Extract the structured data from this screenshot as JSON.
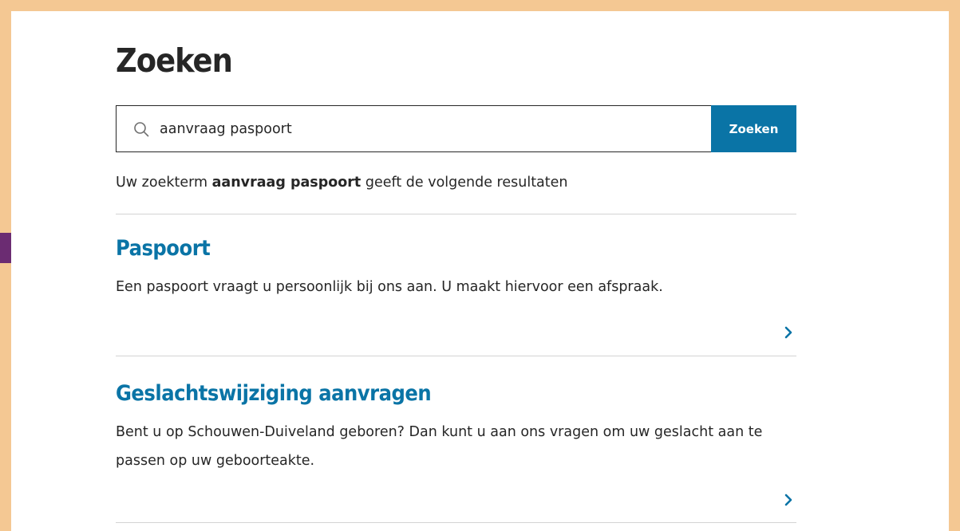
{
  "page": {
    "title": "Zoeken"
  },
  "search": {
    "value": "aanvraag paspoort",
    "button_label": "Zoeken"
  },
  "summary": {
    "prefix": "Uw zoekterm ",
    "term": "aanvraag paspoort",
    "suffix": " geeft de volgende resultaten"
  },
  "results": [
    {
      "title": "Paspoort",
      "description": "Een paspoort vraagt u persoonlijk bij ons aan. U maakt hiervoor een afspraak."
    },
    {
      "title": "Geslachtswijziging aanvragen",
      "description": "Bent u op Schouwen-Duiveland geboren? Dan kunt u aan ons vragen om uw geslacht aan te passen op uw geboorteakte."
    }
  ],
  "colors": {
    "border_frame": "#f4c893",
    "accent": "#0a74a6",
    "annotation_arrow": "#6b2c72",
    "text": "#262626",
    "divider": "#d3d3d3"
  },
  "icons": {
    "search": "search-icon",
    "result_link": "chevron-right-icon",
    "annotation": "arrow-right-icon"
  }
}
